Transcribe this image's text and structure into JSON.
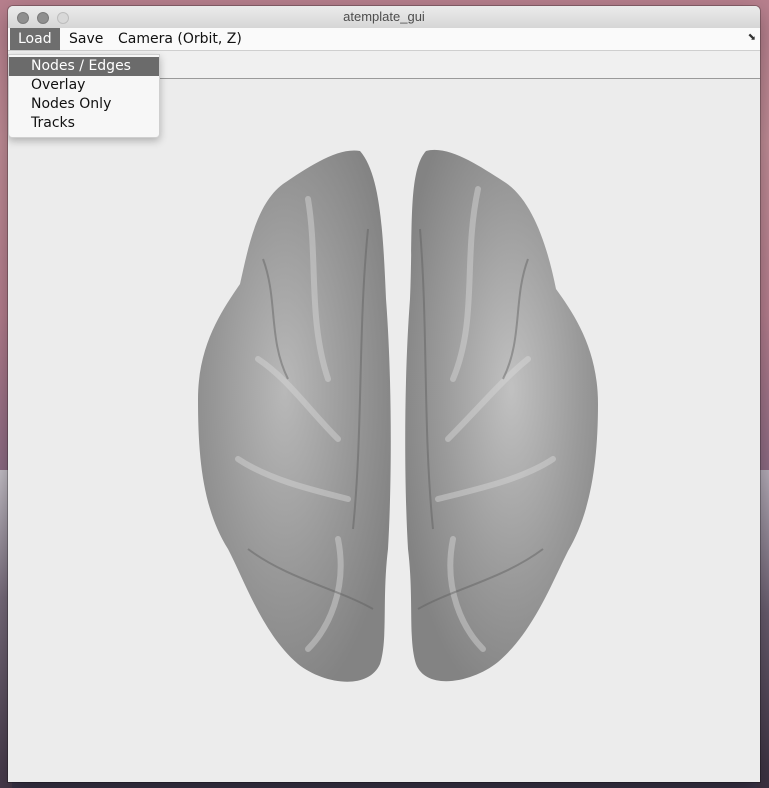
{
  "window": {
    "title": "atemplate_gui"
  },
  "menubar": {
    "load_label": "Load",
    "save_label": "Save",
    "camera_label": "Camera (Orbit, Z)"
  },
  "load_menu": {
    "items": [
      {
        "label": "Nodes / Edges",
        "selected": true
      },
      {
        "label": "Overlay"
      },
      {
        "label": "Nodes Only"
      },
      {
        "label": "Tracks"
      }
    ]
  },
  "viewport": {
    "content": "brain-surface-render",
    "background_color": "#ececec",
    "surface_color": "#8c8c8c"
  }
}
